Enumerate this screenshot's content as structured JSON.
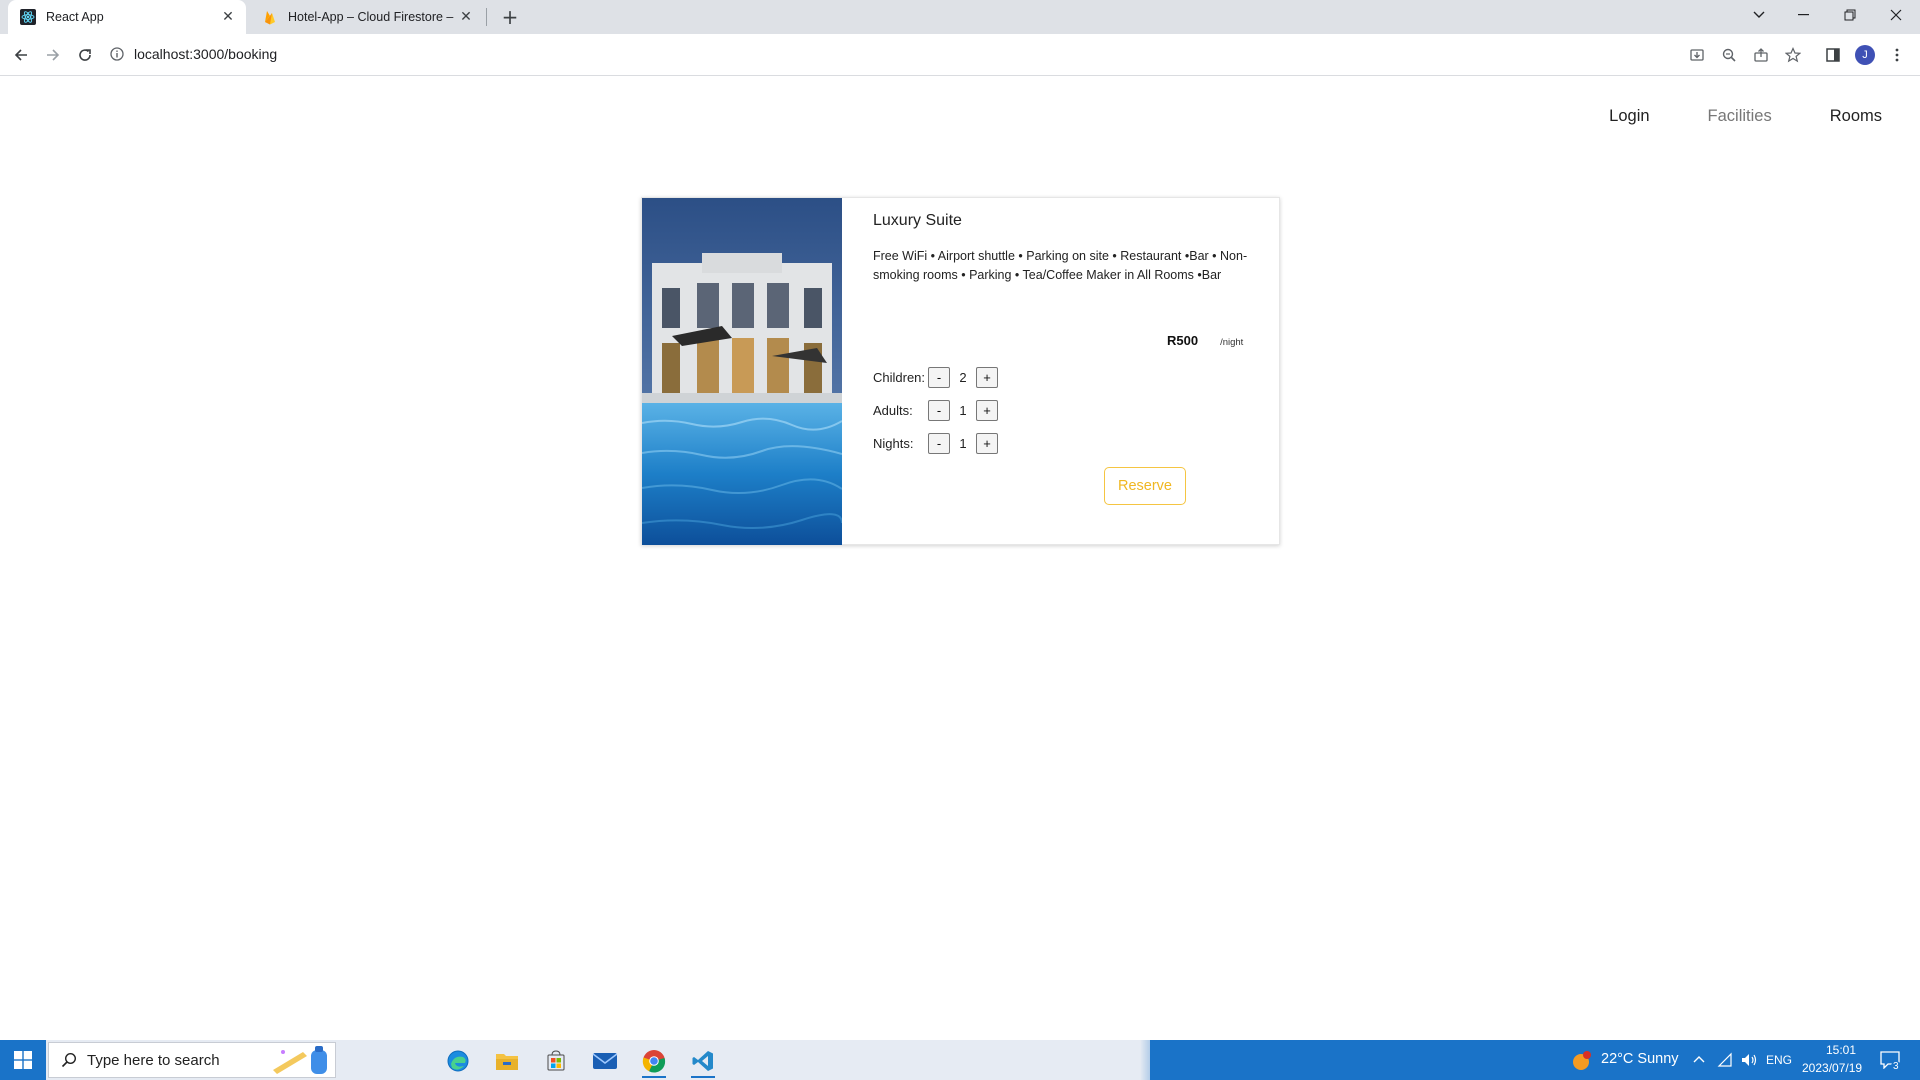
{
  "browser": {
    "tabs": [
      {
        "title": "React App",
        "favicon": "react-icon"
      },
      {
        "title": "Hotel-App – Cloud Firestore – Fi",
        "favicon": "firebase-icon"
      }
    ],
    "url": "localhost:3000/booking",
    "profile_initial": "J"
  },
  "nav": {
    "login": "Login",
    "facilities": "Facilities",
    "rooms": "Rooms"
  },
  "room": {
    "name": "Luxury Suite",
    "amenities": "Free WiFi • Airport shuttle • Parking on site • Restaurant •Bar • Non-smoking rooms • Parking • Tea/Coffee Maker in All Rooms •Bar",
    "price": "R500",
    "per_night": "/night",
    "image": "hotel-pool-photo"
  },
  "booking": {
    "children": {
      "label": "Children:",
      "value": "2"
    },
    "adults": {
      "label": "Adults:",
      "value": "1"
    },
    "nights": {
      "label": "Nights:",
      "value": "1"
    },
    "minus": "-",
    "plus": "+",
    "reserve_label": "Reserve"
  },
  "taskbar": {
    "search_placeholder": "Type here to search",
    "weather": "22°C  Sunny",
    "language": "ENG",
    "time": "15:01",
    "date": "2023/07/19",
    "notification_count": "3"
  },
  "colors": {
    "reserve_accent": "#f0b722",
    "taskbar_blue": "#1a73c8"
  }
}
